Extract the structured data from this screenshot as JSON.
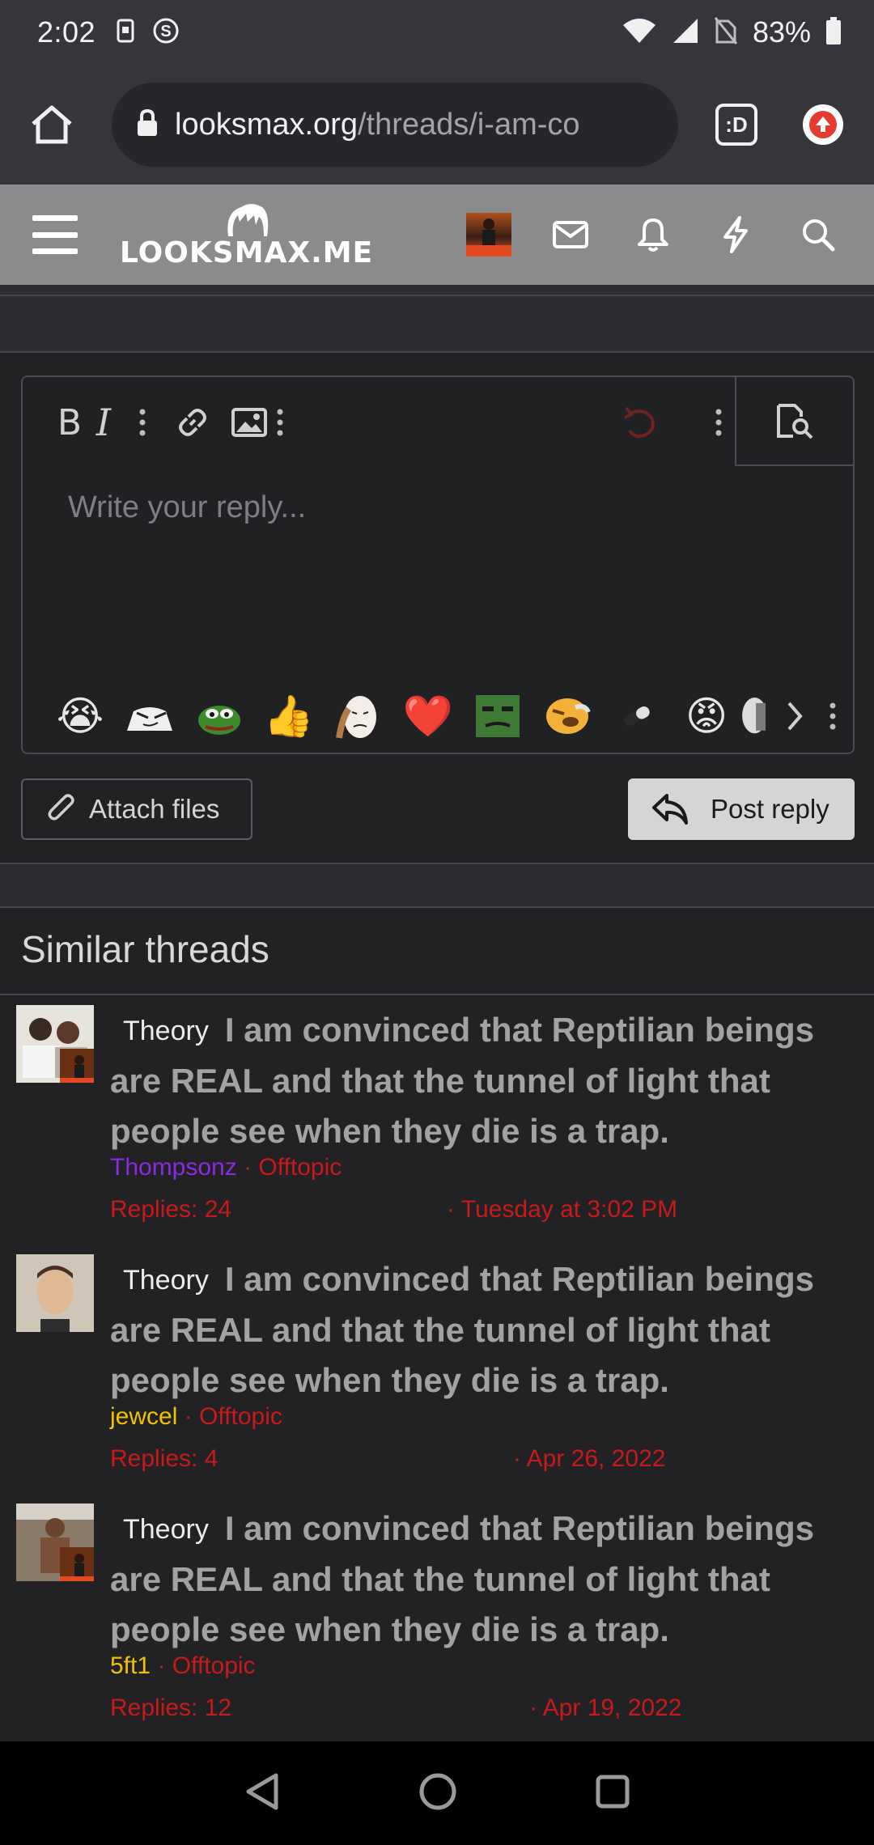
{
  "status_bar": {
    "time": "2:02",
    "battery": "83%"
  },
  "browser": {
    "url_domain": "looksmax.org",
    "url_path": "/threads/i-am-co",
    "tab_icon_label": ":D"
  },
  "site": {
    "logo": "LOOKSMAX.ME"
  },
  "editor": {
    "placeholder": "Write your reply...",
    "bold_label": "B",
    "italic_label": "I",
    "emojis": [
      "😭",
      "",
      "",
      "👍",
      "",
      "❤️",
      "",
      "",
      "",
      "😡",
      ""
    ]
  },
  "actions": {
    "attach_label": "Attach files",
    "post_label": "Post reply"
  },
  "similar": {
    "heading": "Similar threads",
    "threads": [
      {
        "prefix": "Theory",
        "title": "I am convinced that Reptilian beings are REAL and that the tunnel of light that people see when they die is a trap.",
        "author": "Thompsonz",
        "author_color": "#8a2be2",
        "forum": "Offtopic",
        "replies": "Replies: 24",
        "date": "Tuesday at 3:02 PM"
      },
      {
        "prefix": "Theory",
        "title": "I am convinced that Reptilian beings are REAL and that the tunnel of light that people see when they die is a trap.",
        "author": "jewcel",
        "author_color": "#f2c200",
        "forum": "Offtopic",
        "replies": "Replies: 4",
        "date": "Apr 26, 2022"
      },
      {
        "prefix": "Theory",
        "title": "I am convinced that Reptilian beings are REAL and that the tunnel of light that people see when they die is a trap.",
        "author": "5ft1",
        "author_color": "#f2c200",
        "forum": "Offtopic",
        "replies": "Replies: 12",
        "date": "Apr 19, 2022"
      }
    ]
  },
  "colors": {
    "accent_red": "#c81a1a",
    "header_gray": "#8a8b8d",
    "background": "#222224"
  }
}
